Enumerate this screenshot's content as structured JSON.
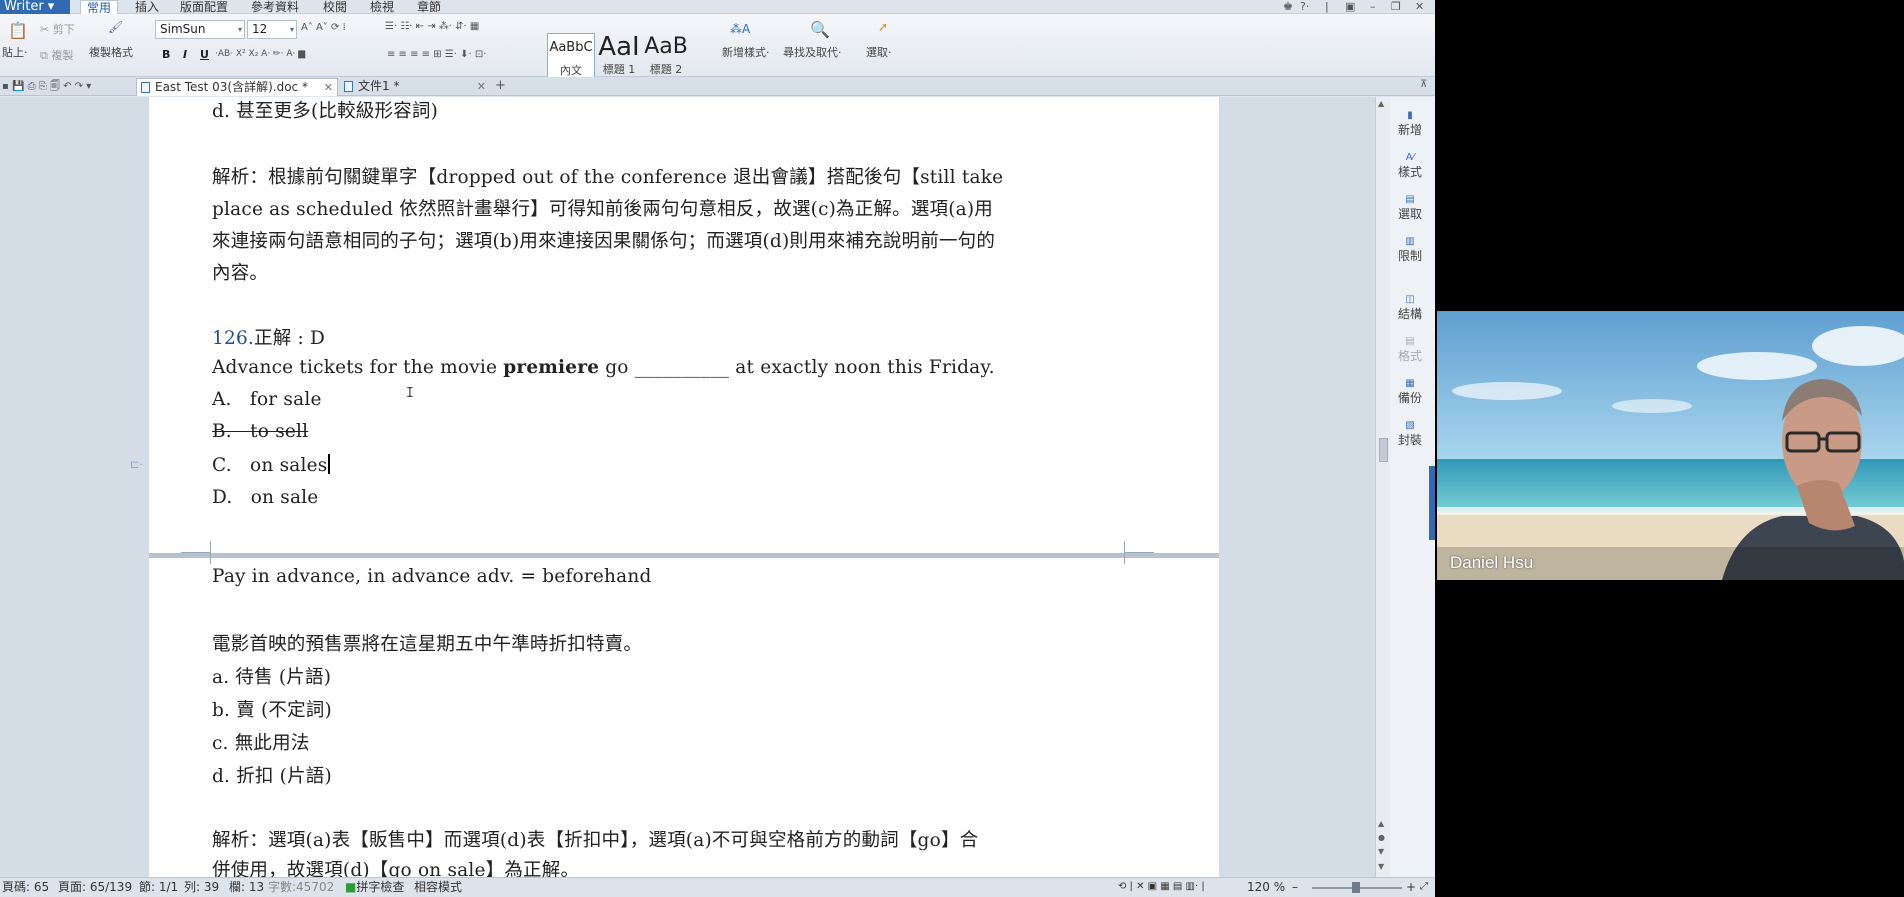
{
  "app": {
    "name": "Writer",
    "menu": [
      "常用",
      "插入",
      "版面配置",
      "參考資料",
      "校閱",
      "檢視",
      "章節"
    ],
    "active_menu": "常用"
  },
  "toolbar": {
    "paste": "貼上",
    "cut": "剪下",
    "copy": "複製",
    "format_painter": "複製格式",
    "font_name": "SimSun",
    "font_size": "12",
    "styles": [
      {
        "sample": "AaBbC",
        "caption": "內文"
      },
      {
        "sample": "AaI",
        "caption": "標題 1"
      },
      {
        "sample": "AaB",
        "caption": "標題 2"
      }
    ],
    "new_style": "新增樣式",
    "find_replace": "尋找及取代",
    "select": "選取"
  },
  "tabs": [
    {
      "label": "East Test 03(含詳解).doc *",
      "active": true
    },
    {
      "label": "文件1 *",
      "active": false
    }
  ],
  "document": {
    "page1": {
      "line_d": "d.  甚至更多(比較級形容詞)",
      "analysis": [
        "解析：根據前句關鍵單字【dropped out of the conference 退出會議】搭配後句【still take",
        "place as scheduled 依然照計畫舉行】可得知前後兩句句意相反，故選(c)為正解。選項(a)用",
        "來連接兩句語意相同的子句；選項(b)用來連接因果關係句；而選項(d)則用來補充說明前一句的",
        "內容。"
      ],
      "question_number": "126.",
      "answer": "正解 : D",
      "question_pre": "Advance tickets for the movie ",
      "question_bold": "premiere",
      "question_post": " go __________ at exactly noon this Friday.",
      "options": [
        {
          "letter": "A.",
          "text": "for sale"
        },
        {
          "letter": "B.",
          "text": "to sell"
        },
        {
          "letter": "C.",
          "text": "on sales"
        },
        {
          "letter": "D.",
          "text": "on sale"
        }
      ]
    },
    "page2": {
      "note": "Pay in advance, in advance adv. = beforehand",
      "translation": "電影首映的預售票將在這星期五中午準時折扣特賣。",
      "explanations": [
        "a.  待售 (片語)",
        "b.  賣 (不定詞)",
        "c.  無此用法",
        "d.  折扣 (片語)"
      ],
      "analysis": [
        "解析：選項(a)表【販售中】而選項(d)表【折扣中】，選項(a)不可與空格前方的動詞【go】合",
        "併使用，故選項(d)【go on sale】為正解。"
      ]
    }
  },
  "task_pane": [
    "新增",
    "樣式",
    "選取",
    "限制",
    "結構",
    "格式",
    "備份",
    "封裝"
  ],
  "status_bar": {
    "page_num": "頁碼: 65",
    "page_of": "頁面: 65/139",
    "section": "節: 1/1",
    "col": "列: 39",
    "row": "欄: 13",
    "words": "字數:45702",
    "spell": "拼字檢查",
    "compat": "相容模式",
    "zoom": "120 %"
  },
  "video": {
    "participant_name": "Daniel Hsu"
  }
}
